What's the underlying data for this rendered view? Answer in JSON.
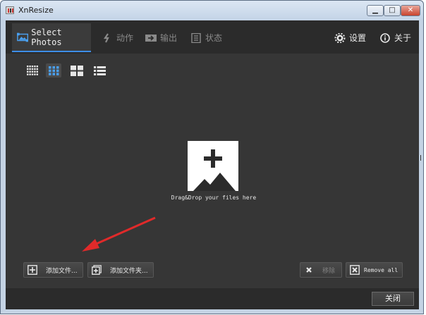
{
  "window": {
    "title": "XnResize",
    "min_glyph": "▁",
    "max_glyph": "□",
    "close_glyph": "✕"
  },
  "tabs": [
    {
      "label": "Select Photos",
      "active": true,
      "icon": "select-photos-icon"
    },
    {
      "label": "动作",
      "icon": "action-icon"
    },
    {
      "label": "输出",
      "icon": "output-icon"
    },
    {
      "label": "状态",
      "icon": "status-icon"
    }
  ],
  "right_tabs": [
    {
      "label": "设置",
      "icon": "gear-icon"
    },
    {
      "label": "关于",
      "icon": "info-icon"
    }
  ],
  "views": [
    {
      "name": "small-grid",
      "active": false
    },
    {
      "name": "medium-grid",
      "active": true
    },
    {
      "name": "large-grid",
      "active": false
    },
    {
      "name": "list",
      "active": false
    }
  ],
  "drop_zone": {
    "hint": "Drag&Drop your files here"
  },
  "buttons": {
    "add_files": "添加文件...",
    "add_folder": "添加文件夹...",
    "remove": "移除",
    "remove_all": "Remove all",
    "close": "关闭"
  },
  "colors": {
    "accent": "#3d8ee8",
    "annotation_arrow": "#e02a2a",
    "panel": "#363636"
  }
}
